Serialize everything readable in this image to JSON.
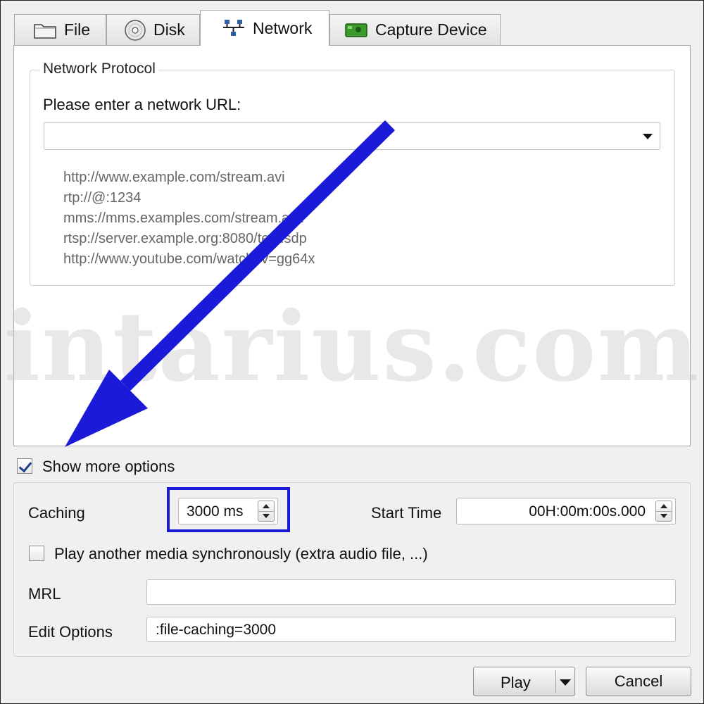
{
  "tabs": [
    {
      "label": "File",
      "icon": "folder-icon"
    },
    {
      "label": "Disk",
      "icon": "disc-icon"
    },
    {
      "label": "Network",
      "icon": "network-icon",
      "active": true
    },
    {
      "label": "Capture Device",
      "icon": "capture-device-icon"
    }
  ],
  "network": {
    "group_title": "Network Protocol",
    "url_label": "Please enter a network URL:",
    "url_value": "",
    "examples": [
      "http://www.example.com/stream.avi",
      "rtp://@:1234",
      "mms://mms.examples.com/stream.asx",
      "rtsp://server.example.org:8080/test.sdp",
      "http://www.youtube.com/watch?v=gg64x"
    ]
  },
  "watermark": "intarius.com",
  "show_more": {
    "label": "Show more options",
    "checked": true
  },
  "options": {
    "caching_label": "Caching",
    "caching_value": "3000 ms",
    "start_time_label": "Start Time",
    "start_time_value": "00H:00m:00s.000",
    "sync_label": "Play another media synchronously (extra audio file, ...)",
    "sync_checked": false,
    "mrl_label": "MRL",
    "mrl_value": "",
    "edit_options_label": "Edit Options",
    "edit_options_value": ":file-caching=3000"
  },
  "buttons": {
    "play": "Play",
    "cancel": "Cancel"
  },
  "colors": {
    "annotation": "#1a1ad8",
    "panel": "#ffffff",
    "background": "#f0f0f0"
  }
}
